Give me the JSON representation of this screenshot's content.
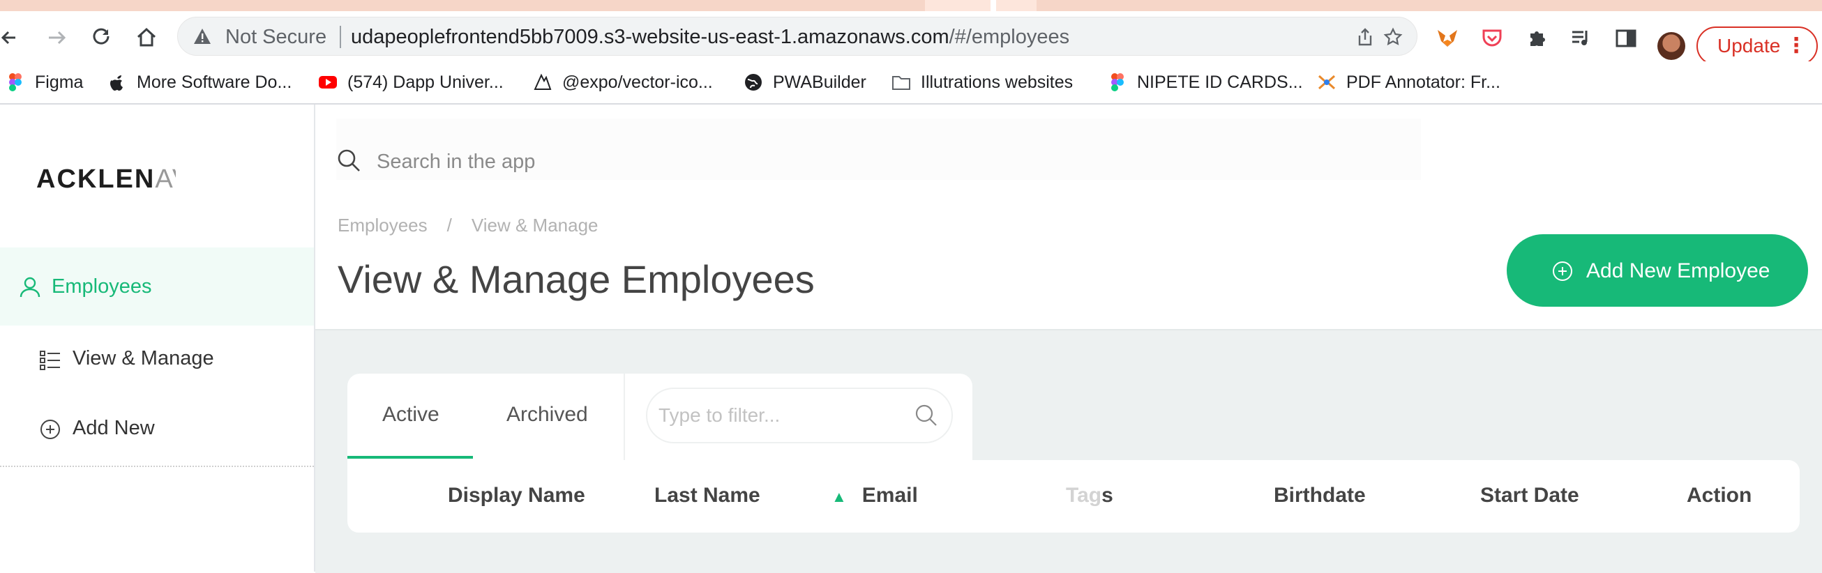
{
  "browser": {
    "security_label": "Not Secure",
    "url_host": "udapeoplefrontend5bb7009.s3-website-us-east-1.amazonaws.com",
    "url_path": "/#/employees",
    "update_label": "Update",
    "bookmarks": [
      {
        "label": "Figma",
        "icon": "figma-icon"
      },
      {
        "label": "More Software Do...",
        "icon": "apple-icon"
      },
      {
        "label": "(574) Dapp Univer...",
        "icon": "youtube-icon"
      },
      {
        "label": "@expo/vector-ico...",
        "icon": "expo-icon"
      },
      {
        "label": "PWABuilder",
        "icon": "globe-icon"
      },
      {
        "label": "Illutrations websites",
        "icon": "folder-icon"
      },
      {
        "label": "NIPETE ID CARDS...",
        "icon": "figma-icon"
      },
      {
        "label": "PDF Annotator: Fr...",
        "icon": "pdf-annotator-icon"
      }
    ]
  },
  "app": {
    "logo_strong": "ACKLEN",
    "logo_fade": "AV",
    "search_placeholder": "Search in the app",
    "sidebar": {
      "section": "Employees",
      "items": [
        {
          "label": "View & Manage",
          "icon": "list-icon"
        },
        {
          "label": "Add New",
          "icon": "plus-circle-icon"
        }
      ]
    },
    "breadcrumb": [
      "Employees",
      "/",
      "View & Manage"
    ],
    "page_title": "View & Manage Employees",
    "add_button": "Add New Employee",
    "tabs": [
      "Active",
      "Archived"
    ],
    "active_tab": "Active",
    "filter_placeholder": "Type to filter...",
    "columns": {
      "display_name": "Display Name",
      "last_name": "Last Name",
      "email": "Email",
      "tags_fade": "Tag",
      "tags_rest": "s",
      "birthdate": "Birthdate",
      "start_date": "Start Date",
      "action": "Action"
    },
    "sort_indicator": "▲",
    "accent": "#17b978"
  }
}
